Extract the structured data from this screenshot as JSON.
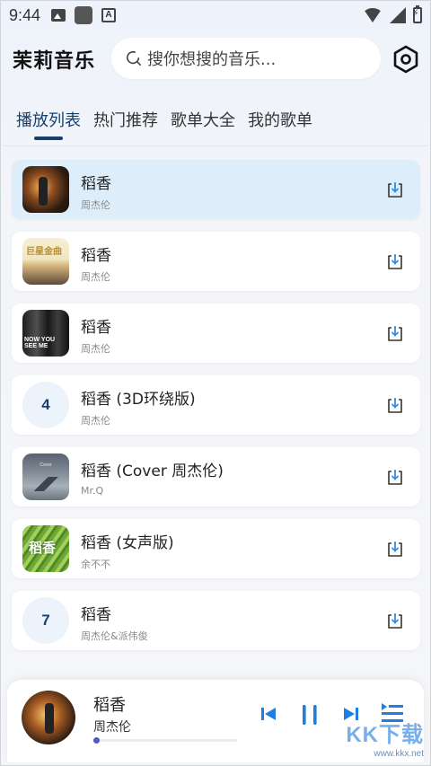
{
  "status_bar": {
    "time": "9:44",
    "icons": [
      "image-icon",
      "square-app-icon",
      "a-app-icon"
    ],
    "right_icons": [
      "wifi-icon",
      "signal-icon",
      "battery-charging-icon"
    ]
  },
  "header": {
    "app_title": "茉莉音乐",
    "search_placeholder": "搜你想搜的音乐...",
    "settings_icon": "hexagon-settings-icon"
  },
  "tabs": [
    {
      "label": "播放列表",
      "active": true
    },
    {
      "label": "热门推荐",
      "active": false
    },
    {
      "label": "歌单大全",
      "active": false
    },
    {
      "label": "我的歌单",
      "active": false
    }
  ],
  "songs": [
    {
      "title": "稻香",
      "artist": "周杰伦",
      "cover": "image",
      "active": true
    },
    {
      "title": "稻香",
      "artist": "周杰伦",
      "cover": "image",
      "cover_text": "巨星金曲",
      "active": false
    },
    {
      "title": "稻香",
      "artist": "周杰伦",
      "cover": "image",
      "cover_text": "NOW YOU SEE ME",
      "active": false
    },
    {
      "title": "稻香 (3D环绕版)",
      "artist": "周杰伦",
      "cover": "number",
      "number": "4",
      "active": false
    },
    {
      "title": "稻香 (Cover 周杰伦)",
      "artist": "Mr.Q",
      "cover": "image",
      "cover_text": "Cover",
      "active": false
    },
    {
      "title": "稻香 (女声版)",
      "artist": "余不不",
      "cover": "image",
      "cover_text": "稻香",
      "active": false
    },
    {
      "title": "稻香",
      "artist": "周杰伦&派伟俊",
      "cover": "number",
      "number": "7",
      "active": false
    }
  ],
  "player": {
    "title": "稻香",
    "artist": "周杰伦",
    "progress": 0.02,
    "controls": [
      "previous-icon",
      "pause-icon",
      "next-icon",
      "playlist-icon"
    ]
  },
  "watermark": {
    "brand": "KK下载",
    "url": "www.kkx.net"
  },
  "colors": {
    "accent": "#15406e",
    "active_row": "#ddeefa",
    "progress": "#4a5cc9",
    "download_arrow": "#2e8fe6"
  }
}
